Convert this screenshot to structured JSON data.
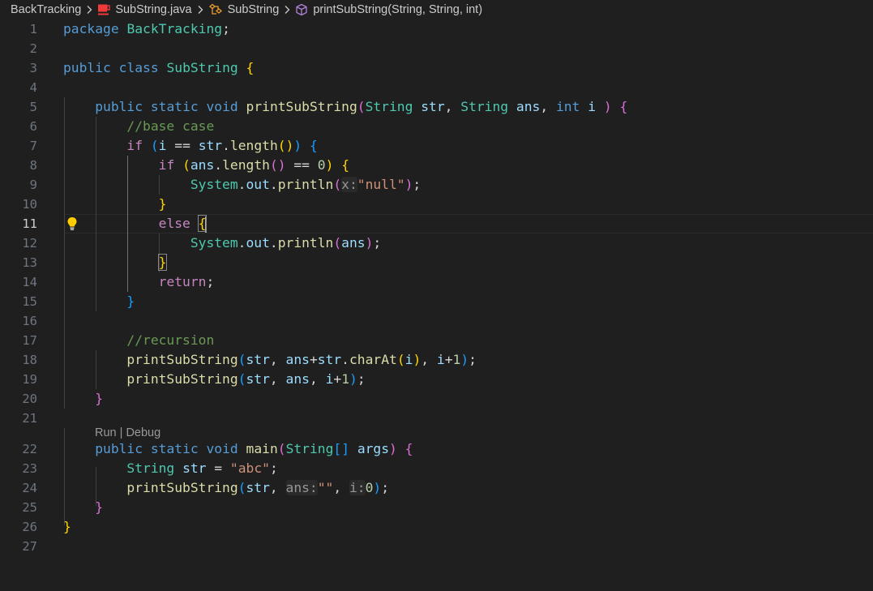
{
  "breadcrumb": {
    "folder": "BackTracking",
    "file": "SubString.java",
    "class": "SubString",
    "method": "printSubString(String, String, int)"
  },
  "editor": {
    "active_line": 11,
    "codelens": {
      "run": "Run",
      "sep": " | ",
      "debug": "Debug"
    },
    "lines": [
      {
        "n": "1"
      },
      {
        "n": "2"
      },
      {
        "n": "3"
      },
      {
        "n": "4"
      },
      {
        "n": "5"
      },
      {
        "n": "6"
      },
      {
        "n": "7"
      },
      {
        "n": "8"
      },
      {
        "n": "9"
      },
      {
        "n": "10"
      },
      {
        "n": "11"
      },
      {
        "n": "12"
      },
      {
        "n": "13"
      },
      {
        "n": "14"
      },
      {
        "n": "15"
      },
      {
        "n": "16"
      },
      {
        "n": "17"
      },
      {
        "n": "18"
      },
      {
        "n": "19"
      },
      {
        "n": "20"
      },
      {
        "n": "21"
      },
      {
        "n": "22"
      },
      {
        "n": "23"
      },
      {
        "n": "24"
      },
      {
        "n": "25"
      },
      {
        "n": "26"
      },
      {
        "n": "27"
      }
    ],
    "tokens": {
      "package": "package",
      "pkgName": "BackTracking",
      "semi": ";",
      "public": "public",
      "class": "class",
      "className": "SubString",
      "static": "static",
      "void": "void",
      "printSubString": "printSubString",
      "String": "String",
      "str": "str",
      "ans": "ans",
      "int": "int",
      "i": "i",
      "comma": ",",
      "lbrace": "{",
      "rbrace": "}",
      "lparen": "(",
      "rparen": ")",
      "comment_base": "//base case",
      "comment_rec": "//recursion",
      "if": "if",
      "else": "else",
      "return": "return",
      "eqeq": "==",
      "length": "length",
      "dot": ".",
      "zero": "0",
      "one": "1",
      "System": "System",
      "out": "out",
      "println": "println",
      "hint_x": "x:",
      "null_str": "\"null\"",
      "plus": "+",
      "charAt": "charAt",
      "main": "main",
      "args": "args",
      "brackets": "[]",
      "assign": "=",
      "abc": "\"abc\"",
      "hint_ans": "ans:",
      "empty_str": "\"\"",
      "hint_i": "i:"
    }
  }
}
